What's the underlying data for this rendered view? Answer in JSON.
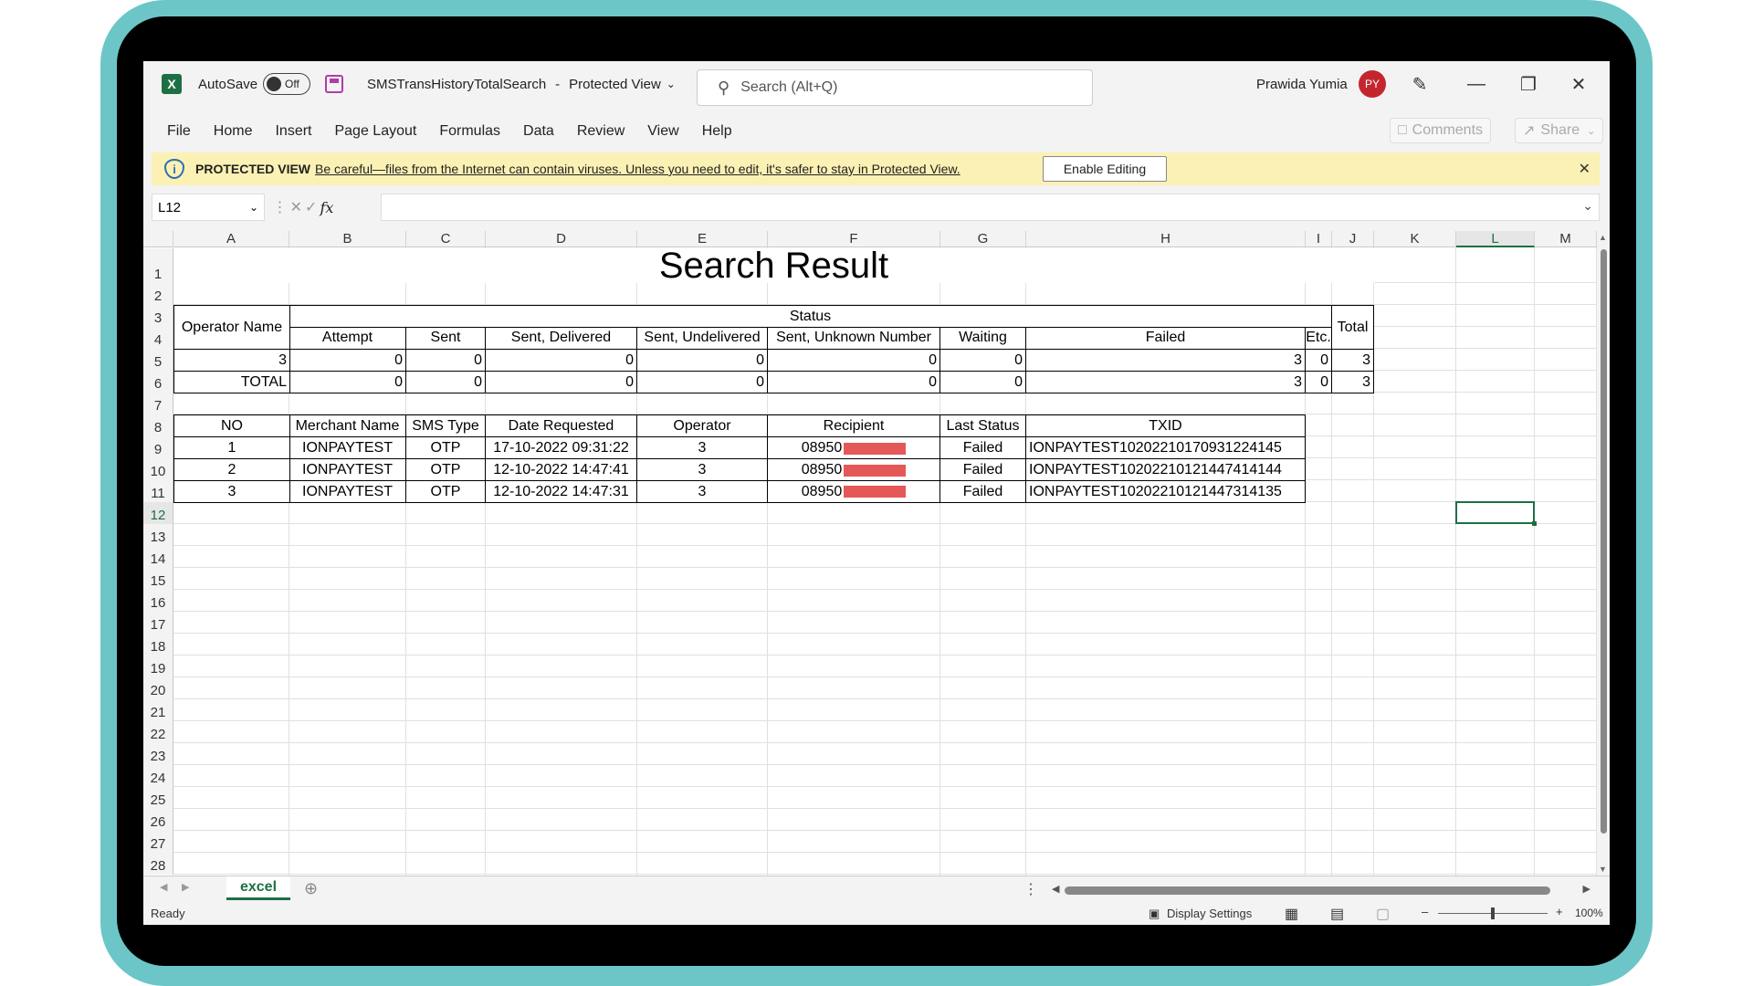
{
  "titlebar": {
    "autosave_label": "AutoSave",
    "autosave_state": "Off",
    "filename": "SMSTransHistoryTotalSearch",
    "separator": "-",
    "view_mode": "Protected View",
    "search_placeholder": "Search (Alt+Q)",
    "user_name": "Prawida Yumia",
    "user_initials": "PY"
  },
  "menu": [
    "File",
    "Home",
    "Insert",
    "Page Layout",
    "Formulas",
    "Data",
    "Review",
    "View",
    "Help"
  ],
  "ribbon_right": {
    "comments": "Comments",
    "share": "Share"
  },
  "protected_bar": {
    "label": "PROTECTED VIEW",
    "message": "Be careful—files from the Internet can contain viruses. Unless you need to edit, it's safer to stay in Protected View.",
    "button": "Enable Editing"
  },
  "formula_bar": {
    "name_box": "L12",
    "fx": "fx",
    "value": ""
  },
  "columns": [
    "A",
    "B",
    "C",
    "D",
    "E",
    "F",
    "G",
    "H",
    "I",
    "J",
    "K",
    "L",
    "M"
  ],
  "rows": [
    "1",
    "2",
    "3",
    "4",
    "5",
    "6",
    "7",
    "8",
    "9",
    "10",
    "11",
    "12",
    "13",
    "14",
    "15",
    "16",
    "17",
    "18",
    "19",
    "20",
    "21",
    "22",
    "23",
    "24",
    "25",
    "26",
    "27",
    "28"
  ],
  "sheet": {
    "title": "Search Result",
    "summary": {
      "operator_header": "Operator Name",
      "status_header": "Status",
      "total_header": "Total",
      "status_columns": [
        "Attempt",
        "Sent",
        "Sent, Delivered",
        "Sent, Undelivered",
        "Sent, Unknown Number",
        "Waiting",
        "Failed",
        "Etc."
      ],
      "rows": [
        {
          "name": "3",
          "values": [
            "0",
            "0",
            "0",
            "0",
            "0",
            "0",
            "3",
            "0"
          ],
          "total": "3"
        },
        {
          "name": "TOTAL",
          "values": [
            "0",
            "0",
            "0",
            "0",
            "0",
            "0",
            "3",
            "0"
          ],
          "total": "3"
        }
      ]
    },
    "detail": {
      "headers": [
        "NO",
        "Merchant Name",
        "SMS Type",
        "Date Requested",
        "Operator",
        "Recipient",
        "Last Status",
        "TXID"
      ],
      "rows": [
        {
          "no": "1",
          "merchant": "IONPAYTEST",
          "type": "OTP",
          "date": "17-10-2022 09:31:22",
          "operator": "3",
          "recipient": "08950",
          "status": "Failed",
          "txid": "IONPAYTEST10202210170931224145"
        },
        {
          "no": "2",
          "merchant": "IONPAYTEST",
          "type": "OTP",
          "date": "12-10-2022 14:47:41",
          "operator": "3",
          "recipient": "08950",
          "status": "Failed",
          "txid": "IONPAYTEST10202210121447414144"
        },
        {
          "no": "3",
          "merchant": "IONPAYTEST",
          "type": "OTP",
          "date": "12-10-2022 14:47:31",
          "operator": "3",
          "recipient": "08950",
          "status": "Failed",
          "txid": "IONPAYTEST10202210121447314135"
        }
      ]
    }
  },
  "sheet_tab": "excel",
  "statusbar": {
    "ready": "Ready",
    "display_settings": "Display Settings",
    "zoom": "100%"
  },
  "colors": {
    "excel_green": "#1d7044",
    "protected_bg": "#fbf1b4",
    "redaction": "#e55858",
    "avatar": "#c4262e"
  }
}
